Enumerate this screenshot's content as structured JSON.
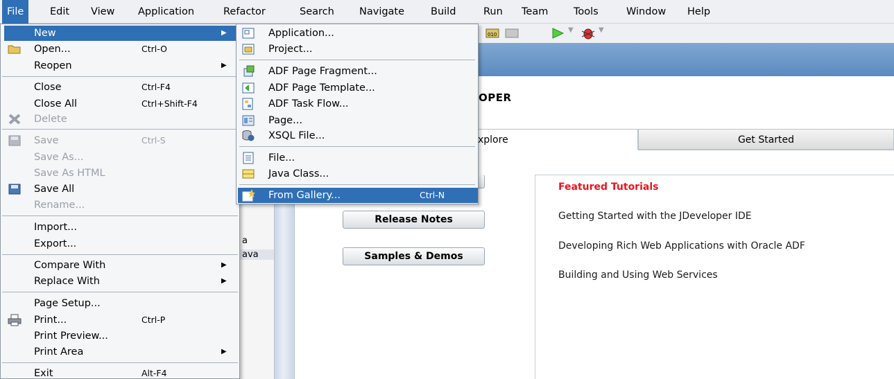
{
  "menubar": [
    "File",
    "Edit",
    "View",
    "Application",
    "Refactor",
    "Search",
    "Navigate",
    "Build",
    "Run",
    "Team",
    "Tools",
    "Window",
    "Help"
  ],
  "background": {
    "title": "OPER",
    "tab_explore": "xplore",
    "tab_get_started": "Get Started",
    "buttons": [
      "Release Notes",
      "Samples & Demos"
    ],
    "stubs": [
      "a",
      "ava"
    ],
    "featured_title": "Featured Tutorials",
    "featured_links": [
      "Getting Started with the JDeveloper IDE",
      "Developing Rich Web Applications with Oracle ADF",
      "Building and Using Web Services"
    ]
  },
  "file_menu": {
    "new": "New",
    "open": "Open...",
    "open_sc": "Ctrl-O",
    "reopen": "Reopen",
    "close": "Close",
    "close_sc": "Ctrl-F4",
    "close_all": "Close All",
    "close_all_sc": "Ctrl+Shift-F4",
    "delete": "Delete",
    "save": "Save",
    "save_sc": "Ctrl-S",
    "save_as": "Save As...",
    "save_as_html": "Save As HTML",
    "save_all": "Save All",
    "rename": "Rename...",
    "import": "Import...",
    "export": "Export...",
    "compare_with": "Compare With",
    "replace_with": "Replace With",
    "page_setup": "Page Setup...",
    "print": "Print...",
    "print_sc": "Ctrl-P",
    "print_preview": "Print Preview...",
    "print_area": "Print Area",
    "exit": "Exit",
    "exit_sc": "Alt-F4"
  },
  "new_menu": {
    "application": "Application...",
    "project": "Project...",
    "adf_page_fragment": "ADF Page Fragment...",
    "adf_page_template": "ADF Page Template...",
    "adf_task_flow": "ADF Task Flow...",
    "page": "Page...",
    "xsql_file": "XSQL File...",
    "file": "File...",
    "java_class": "Java Class...",
    "from_gallery": "From Gallery...",
    "from_gallery_sc": "Ctrl-N"
  },
  "colors": {
    "highlight": "#2f6fb6",
    "featured": "#e8141e"
  }
}
